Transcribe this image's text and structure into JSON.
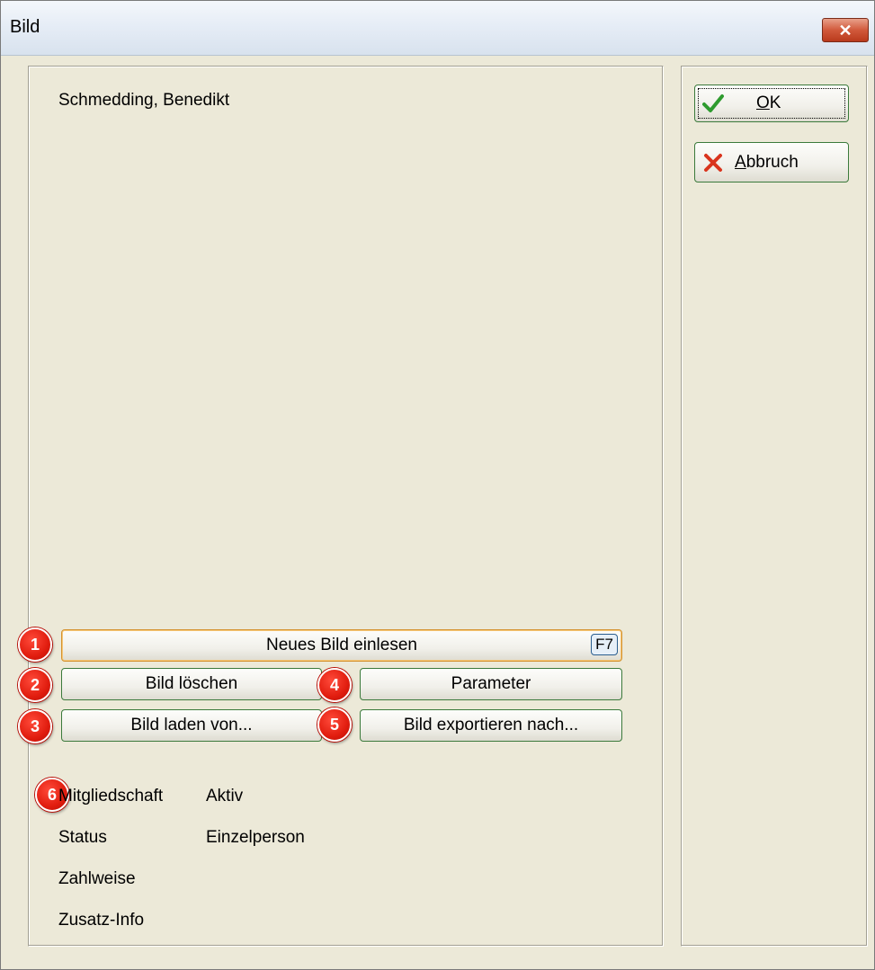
{
  "window": {
    "title": "Bild"
  },
  "person": {
    "name": "Schmedding, Benedikt"
  },
  "buttons": {
    "new_image": "Neues Bild einlesen",
    "new_image_shortcut": "F7",
    "delete_image": "Bild löschen",
    "parameters": "Parameter",
    "load_from": "Bild laden von...",
    "export_to": "Bild exportieren nach..."
  },
  "side": {
    "ok_label_underlined": "O",
    "ok_label_rest": "K",
    "cancel_label_underlined": "A",
    "cancel_label_rest": "bbruch"
  },
  "markers": [
    "1",
    "2",
    "3",
    "4",
    "5",
    "6"
  ],
  "info": {
    "membership_label": "Mitgliedschaft",
    "membership_value": "Aktiv",
    "status_label": "Status",
    "status_value": "Einzelperson",
    "payment_label": "Zahlweise",
    "payment_value": "",
    "extra_label": "Zusatz-Info",
    "extra_value": ""
  },
  "colors": {
    "accent_marker": "#e11d0f",
    "button_border": "#3b7a3b",
    "focus_border": "#d4912d",
    "background": "#ece9d8"
  },
  "icons": {
    "ok": "checkmark-icon",
    "cancel": "cross-icon",
    "close": "close-icon"
  }
}
